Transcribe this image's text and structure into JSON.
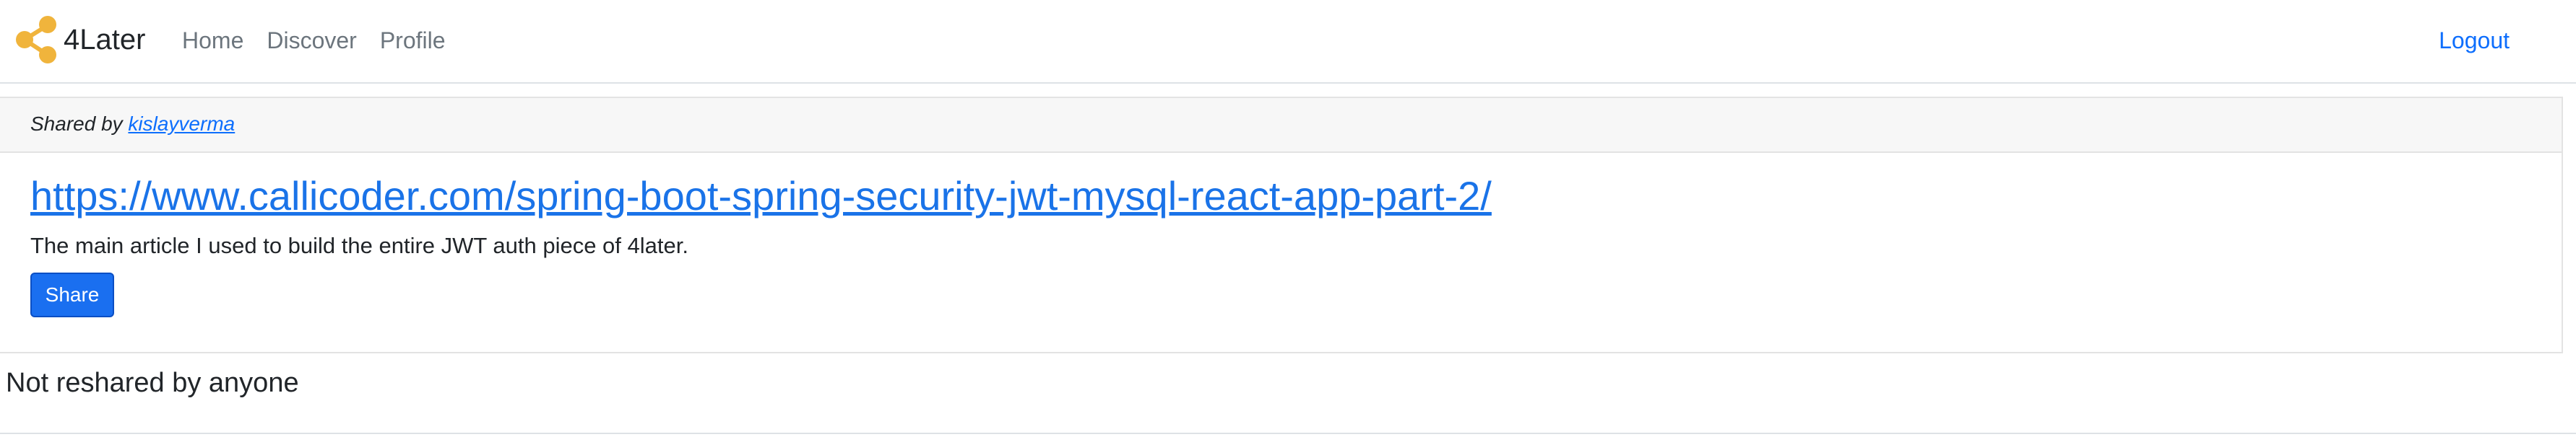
{
  "navbar": {
    "brand": "4Later",
    "links": [
      {
        "label": "Home"
      },
      {
        "label": "Discover"
      },
      {
        "label": "Profile"
      }
    ],
    "logout_label": "Logout"
  },
  "share": {
    "shared_by_prefix": "Shared by",
    "shared_by_user": "kislayverma",
    "url": "https://www.callicoder.com/spring-boot-spring-security-jwt-mysql-react-app-part-2/",
    "description": "The main article I used to build the entire JWT auth piece of 4later.",
    "share_button_label": "Share"
  },
  "reshares": {
    "title": "Not reshared by anyone"
  },
  "colors": {
    "link": "#1a73e8",
    "primary_button": "#1a6ff0",
    "logo": "#f0b43c"
  },
  "icons": {
    "brand_logo": "share-nodes-icon"
  }
}
